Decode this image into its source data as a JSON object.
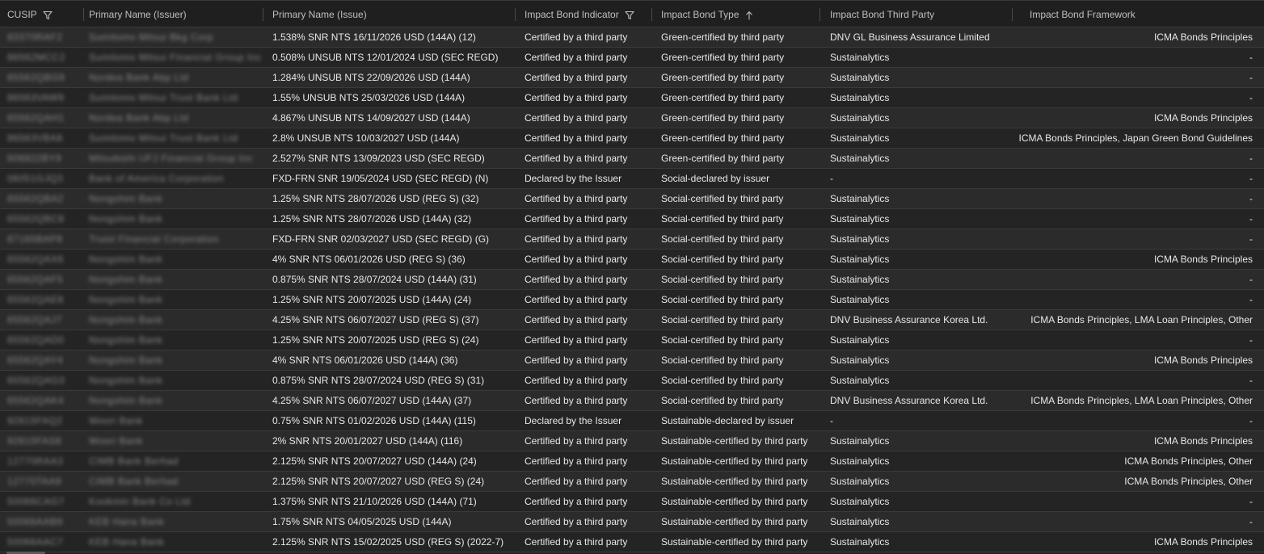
{
  "columns": {
    "cusip": "CUSIP",
    "issuer": "Primary Name (Issuer)",
    "issue": "Primary Name (Issue)",
    "indicator": "Impact Bond Indicator",
    "type": "Impact Bond Type",
    "third_party": "Impact Bond Third Party",
    "framework": "Impact Bond Framework"
  },
  "icons": {
    "cusip_filter": "filter-icon",
    "indicator_filter": "filter-icon",
    "type_sort": "sort-ascending-arrow-icon"
  },
  "rows": [
    {
      "cusip": "83370RAF2",
      "issuer": "Sumitomo Mitsui Bkg Corp",
      "issue": "1.538% SNR NTS 16/11/2026 USD (144A) (12)",
      "indicator": "Certified by a third party",
      "type": "Green-certified by third party",
      "third_party": "DNV GL Business Assurance Limited",
      "framework": "ICMA Bonds Principles"
    },
    {
      "cusip": "86562MCC2",
      "issuer": "Sumitomo Mitsui Financial Group Inc",
      "issue": "0.508% UNSUB NTS 12/01/2024 USD (SEC REGD)",
      "indicator": "Certified by a third party",
      "type": "Green-certified by third party",
      "third_party": "Sustainalytics",
      "framework": "-"
    },
    {
      "cusip": "65562QBG9",
      "issuer": "Nordea Bank Abp Ltd",
      "issue": "1.284% UNSUB NTS 22/09/2026 USD (144A)",
      "indicator": "Certified by a third party",
      "type": "Green-certified by third party",
      "third_party": "Sustainalytics",
      "framework": "-"
    },
    {
      "cusip": "86563VAW9",
      "issuer": "Sumitomo Mitsui Trust Bank Ltd",
      "issue": "1.55% UNSUB NTS 25/03/2026 USD (144A)",
      "indicator": "Certified by a third party",
      "type": "Green-certified by third party",
      "third_party": "Sustainalytics",
      "framework": "-"
    },
    {
      "cusip": "65562QAH1",
      "issuer": "Nordea Bank Abp Ltd",
      "issue": "4.867% UNSUB NTS 14/09/2027 USD (144A)",
      "indicator": "Certified by a third party",
      "type": "Green-certified by third party",
      "third_party": "Sustainalytics",
      "framework": "ICMA Bonds Principles"
    },
    {
      "cusip": "86563VBA8",
      "issuer": "Sumitomo Mitsui Trust Bank Ltd",
      "issue": "2.8% UNSUB NTS 10/03/2027 USD (144A)",
      "indicator": "Certified by a third party",
      "type": "Green-certified by third party",
      "third_party": "Sustainalytics",
      "framework": "ICMA Bonds Principles, Japan Green Bond Guidelines"
    },
    {
      "cusip": "606822BY9",
      "issuer": "Mitsubishi UFJ Financial Group Inc",
      "issue": "2.527% SNR NTS 13/09/2023 USD (SEC REGD)",
      "indicator": "Certified by a third party",
      "type": "Green-certified by third party",
      "third_party": "Sustainalytics",
      "framework": "-"
    },
    {
      "cusip": "06051GJQ3",
      "issuer": "Bank of America Corporation",
      "issue": "FXD-FRN SNR 19/05/2024 USD (SEC REGD) (N)",
      "indicator": "Declared by the Issuer",
      "type": "Social-declared by issuer",
      "third_party": "-",
      "framework": "-"
    },
    {
      "cusip": "65562QBA2",
      "issuer": "Nongshim Bank",
      "issue": "1.25% SNR NTS 28/07/2026 USD (REG S) (32)",
      "indicator": "Certified by a third party",
      "type": "Social-certified by third party",
      "third_party": "Sustainalytics",
      "framework": "-"
    },
    {
      "cusip": "65562QBC8",
      "issuer": "Nongshim Bank",
      "issue": "1.25% SNR NTS 28/07/2026 USD (144A) (32)",
      "indicator": "Certified by a third party",
      "type": "Social-certified by third party",
      "third_party": "Sustainalytics",
      "framework": "-"
    },
    {
      "cusip": "87165BAP8",
      "issuer": "Truist Financial Corporation",
      "issue": "FXD-FRN SNR 02/03/2027 USD (SEC REGD) (G)",
      "indicator": "Certified by a third party",
      "type": "Social-certified by third party",
      "third_party": "Sustainalytics",
      "framework": "-"
    },
    {
      "cusip": "65562QAX6",
      "issuer": "Nongshim Bank",
      "issue": "4% SNR NTS 06/01/2026 USD (REG S) (36)",
      "indicator": "Certified by a third party",
      "type": "Social-certified by third party",
      "third_party": "Sustainalytics",
      "framework": "ICMA Bonds Principles"
    },
    {
      "cusip": "65562QAF5",
      "issuer": "Nongshim Bank",
      "issue": "0.875% SNR NTS 28/07/2024 USD (144A) (31)",
      "indicator": "Certified by a third party",
      "type": "Social-certified by third party",
      "third_party": "Sustainalytics",
      "framework": "-"
    },
    {
      "cusip": "65562QAE8",
      "issuer": "Nongshim Bank",
      "issue": "1.25% SNR NTS 20/07/2025 USD (144A) (24)",
      "indicator": "Certified by a third party",
      "type": "Social-certified by third party",
      "third_party": "Sustainalytics",
      "framework": "-"
    },
    {
      "cusip": "65562QAJ7",
      "issuer": "Nongshim Bank",
      "issue": "4.25% SNR NTS 06/07/2027 USD (REG S) (37)",
      "indicator": "Certified by a third party",
      "type": "Social-certified by third party",
      "third_party": "DNV Business Assurance Korea Ltd.",
      "framework": "ICMA Bonds Principles, LMA Loan Principles, Other"
    },
    {
      "cusip": "65562QAD0",
      "issuer": "Nongshim Bank",
      "issue": "1.25% SNR NTS 20/07/2025 USD (REG S) (24)",
      "indicator": "Certified by a third party",
      "type": "Social-certified by third party",
      "third_party": "Sustainalytics",
      "framework": "-"
    },
    {
      "cusip": "65562QAY4",
      "issuer": "Nongshim Bank",
      "issue": "4% SNR NTS 06/01/2026 USD (144A) (36)",
      "indicator": "Certified by a third party",
      "type": "Social-certified by third party",
      "third_party": "Sustainalytics",
      "framework": "ICMA Bonds Principles"
    },
    {
      "cusip": "65562QAG3",
      "issuer": "Nongshim Bank",
      "issue": "0.875% SNR NTS 28/07/2024 USD (REG S) (31)",
      "indicator": "Certified by a third party",
      "type": "Social-certified by third party",
      "third_party": "Sustainalytics",
      "framework": "-"
    },
    {
      "cusip": "65562QAK4",
      "issuer": "Nongshim Bank",
      "issue": "4.25% SNR NTS 06/07/2027 USD (144A) (37)",
      "indicator": "Certified by a third party",
      "type": "Social-certified by third party",
      "third_party": "DNV Business Assurance Korea Ltd.",
      "framework": "ICMA Bonds Principles, LMA Loan Principles, Other"
    },
    {
      "cusip": "92815FAQ2",
      "issuer": "Woori Bank",
      "issue": "0.75% SNR NTS 01/02/2026 USD (144A) (115)",
      "indicator": "Declared by the Issuer",
      "type": "Sustainable-declared by issuer",
      "third_party": "-",
      "framework": "-"
    },
    {
      "cusip": "92815FAS8",
      "issuer": "Woori Bank",
      "issue": "2% SNR NTS 20/01/2027 USD (144A) (116)",
      "indicator": "Certified by a third party",
      "type": "Sustainable-certified by third party",
      "third_party": "Sustainalytics",
      "framework": "ICMA Bonds Principles"
    },
    {
      "cusip": "12770RAA3",
      "issuer": "CIMB Bank Berhad",
      "issue": "2.125% SNR NTS 20/07/2027 USD (144A) (24)",
      "indicator": "Certified by a third party",
      "type": "Sustainable-certified by third party",
      "third_party": "Sustainalytics",
      "framework": "ICMA Bonds Principles, Other"
    },
    {
      "cusip": "12770TAA9",
      "issuer": "CIMB Bank Berhad",
      "issue": "2.125% SNR NTS 20/07/2027 USD (REG S) (24)",
      "indicator": "Certified by a third party",
      "type": "Sustainable-certified by third party",
      "third_party": "Sustainalytics",
      "framework": "ICMA Bonds Principles, Other"
    },
    {
      "cusip": "50066CAG7",
      "issuer": "Kookmin Bank Co Ltd",
      "issue": "1.375% SNR NTS 21/10/2026 USD (144A) (71)",
      "indicator": "Certified by a third party",
      "type": "Sustainable-certified by third party",
      "third_party": "Sustainalytics",
      "framework": "-"
    },
    {
      "cusip": "50066AAB9",
      "issuer": "KEB Hana Bank",
      "issue": "1.75% SNR NTS 04/05/2025 USD (144A)",
      "indicator": "Certified by a third party",
      "type": "Sustainable-certified by third party",
      "third_party": "Sustainalytics",
      "framework": "-"
    },
    {
      "cusip": "50066AAC7",
      "issuer": "KEB Hana Bank",
      "issue": "2.125% SNR NTS 15/02/2025 USD (REG S) (2022-7)",
      "indicator": "Certified by a third party",
      "type": "Sustainable-certified by third party",
      "third_party": "Sustainalytics",
      "framework": "ICMA Bonds Principles"
    }
  ]
}
